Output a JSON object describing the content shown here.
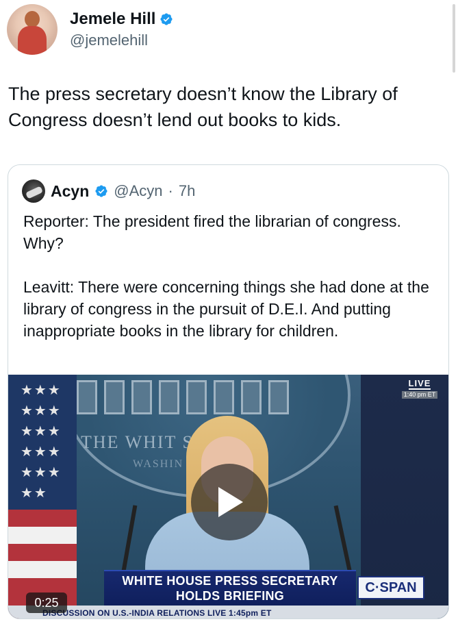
{
  "author": {
    "display_name": "Jemele Hill",
    "handle": "@jemelehill"
  },
  "tweet": {
    "text": "The press secretary doesn’t know the Library of Congress doesn’t lend out books to kids."
  },
  "quoted_tweet": {
    "display_name": "Acyn",
    "handle": "@Acyn",
    "separator": "·",
    "time": "7h",
    "paragraphs": [
      "Reporter: The president fired the librarian of congress. Why?",
      "Leavitt: There were concerning things she had done at the library of congress in the pursuit of D.E.I. And putting inappropriate books in the library for children."
    ],
    "video": {
      "duration": "0:25",
      "live_label": "LIVE",
      "live_time": "1:40 pm ET",
      "sign_line1": "THE WHIT      SE",
      "sign_line2": "WASHIN",
      "chyron_line1": "WHITE HOUSE PRESS SECRETARY",
      "chyron_line2": "HOLDS BRIEFING",
      "network": "C·SPAN",
      "ticker": "DISCUSSION ON U.S.-INDIA RELATIONS  LIVE 1:45pm ET"
    }
  },
  "icons": {
    "verified": "verified-badge-icon",
    "play": "play-icon"
  },
  "colors": {
    "verified_blue": "#1d9bf0",
    "text": "#0f1419",
    "secondary_text": "#536471",
    "border": "#cfd9de"
  }
}
